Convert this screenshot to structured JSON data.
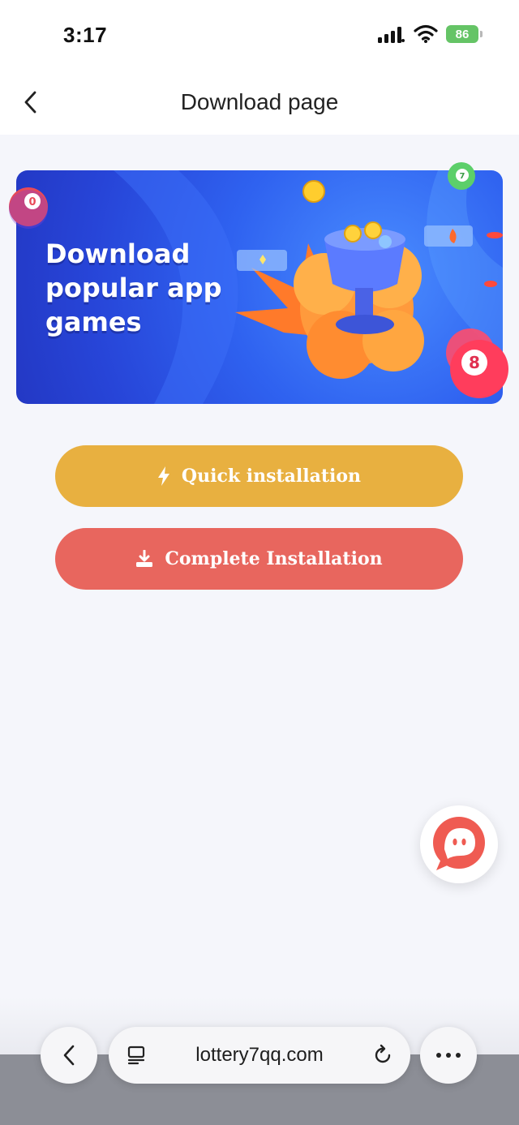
{
  "status_bar": {
    "time": "3:17",
    "battery": "86"
  },
  "header": {
    "title": "Download page",
    "back_icon": "chevron-left-icon"
  },
  "banner": {
    "line1": "Download",
    "line2": "popular app",
    "line3": "games"
  },
  "buttons": {
    "quick_label": "Quick installation",
    "quick_icon": "lightning-icon",
    "complete_label": "Complete Installation",
    "complete_icon": "download-icon"
  },
  "chat": {
    "icon": "chat-bubble-icon"
  },
  "browser": {
    "url": "lottery7qq.com",
    "back_icon": "chevron-left-icon",
    "tabs_icon": "tabs-icon",
    "reload_icon": "reload-icon",
    "more_icon": "more-icon"
  },
  "colors": {
    "quick_button": "#e8b040",
    "complete_button": "#e8665e",
    "page_background": "#f5f6fb",
    "banner_blue": "#2f62f0",
    "chat_red": "#ef5b52"
  }
}
